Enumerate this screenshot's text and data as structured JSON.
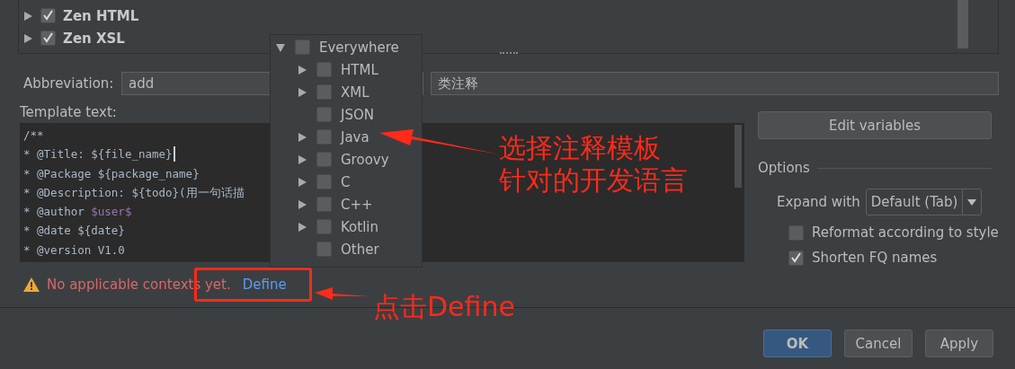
{
  "templates_tree": [
    {
      "label": "Zen HTML",
      "checked": true,
      "expanded": false
    },
    {
      "label": "Zen XSL",
      "checked": true,
      "expanded": false
    }
  ],
  "abbreviation": {
    "label": "Abbreviation:",
    "value": "add"
  },
  "description": {
    "value": "类注释"
  },
  "template_text": {
    "label": "Template text:",
    "lines": [
      [
        {
          "text": "/**"
        }
      ],
      [
        {
          "text": "* @Title: ${file_name}"
        },
        {
          "kind": "cursor"
        }
      ],
      [
        {
          "text": "* @Package ${package_name}"
        }
      ],
      [
        {
          "text": "* @Description: ${todo}(用一句话描"
        }
      ],
      [
        {
          "text": "* @author "
        },
        {
          "text": "$user$",
          "kind": "variable"
        }
      ],
      [
        {
          "text": "* @date ${date}"
        }
      ],
      [
        {
          "text": "* @version V1.0"
        }
      ]
    ]
  },
  "contexts_popup": [
    {
      "label": "Everywhere",
      "kind": "branch",
      "expanded": true,
      "checked": false,
      "children": [
        {
          "label": "HTML",
          "kind": "branch",
          "expanded": false,
          "checked": false
        },
        {
          "label": "XML",
          "kind": "branch",
          "expanded": false,
          "checked": false
        },
        {
          "label": "JSON",
          "kind": "leaf",
          "checked": false
        },
        {
          "label": "Java",
          "kind": "branch",
          "expanded": false,
          "checked": false
        },
        {
          "label": "Groovy",
          "kind": "branch",
          "expanded": false,
          "checked": false
        },
        {
          "label": "C",
          "kind": "branch",
          "expanded": false,
          "checked": false
        },
        {
          "label": "C++",
          "kind": "branch",
          "expanded": false,
          "checked": false
        },
        {
          "label": "Kotlin",
          "kind": "branch",
          "expanded": false,
          "checked": false
        },
        {
          "label": "Other",
          "kind": "leaf",
          "checked": false
        }
      ]
    }
  ],
  "edit_variables_button": "Edit variables",
  "options": {
    "title": "Options",
    "expand_with": {
      "label": "Expand with",
      "value": "Default (Tab)"
    },
    "checkboxes": [
      {
        "label": "Reformat according to style",
        "checked": false
      },
      {
        "label": "Shorten FQ names",
        "checked": true
      }
    ]
  },
  "warning": {
    "text": "No applicable contexts yet.",
    "link": "Define"
  },
  "annotations": [
    {
      "lines": [
        "选择注释模板",
        "针对的开发语言"
      ]
    },
    {
      "lines": [
        "点击Define"
      ]
    }
  ],
  "buttons": [
    {
      "label": "OK",
      "selected": true
    },
    {
      "label": "Cancel",
      "selected": false
    },
    {
      "label": "Apply",
      "selected": false
    }
  ]
}
